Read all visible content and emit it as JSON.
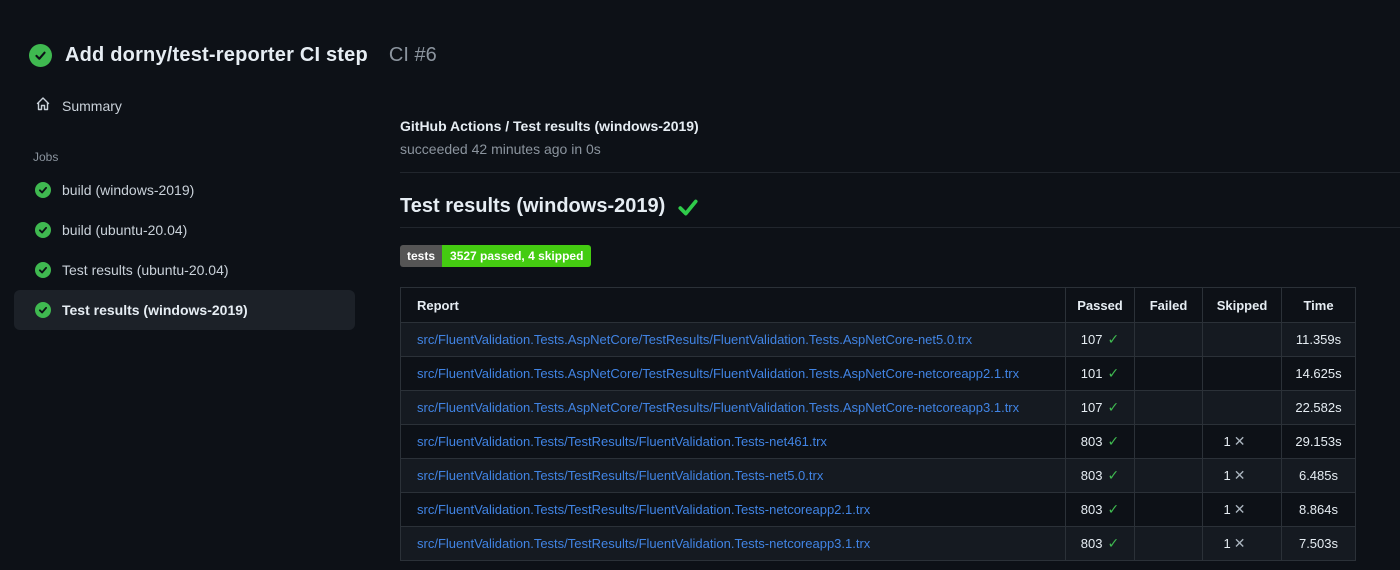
{
  "header": {
    "title": "Add dorny/test-reporter CI step",
    "run_number": "CI #6"
  },
  "sidebar": {
    "summary_label": "Summary",
    "jobs_label": "Jobs",
    "jobs": [
      {
        "label": "build (windows-2019)",
        "status": "success",
        "selected": false
      },
      {
        "label": "build (ubuntu-20.04)",
        "status": "success",
        "selected": false
      },
      {
        "label": "Test results (ubuntu-20.04)",
        "status": "success",
        "selected": false
      },
      {
        "label": "Test results (windows-2019)",
        "status": "success",
        "selected": true
      }
    ]
  },
  "main": {
    "check_run_title": "GitHub Actions / Test results (windows-2019)",
    "check_run_status": "succeeded 42 minutes ago in 0s",
    "section_title": "Test results (windows-2019)",
    "badge": {
      "label": "tests",
      "value": "3527 passed, 4 skipped",
      "label_bg": "#555555",
      "value_bg": "#44cc11"
    },
    "table": {
      "columns": [
        "Report",
        "Passed",
        "Failed",
        "Skipped",
        "Time"
      ],
      "rows": [
        {
          "report": "src/FluentValidation.Tests.AspNetCore/TestResults/FluentValidation.Tests.AspNetCore-net5.0.trx",
          "passed": "107",
          "failed": "",
          "skipped": "",
          "time": "11.359s"
        },
        {
          "report": "src/FluentValidation.Tests.AspNetCore/TestResults/FluentValidation.Tests.AspNetCore-netcoreapp2.1.trx",
          "passed": "101",
          "failed": "",
          "skipped": "",
          "time": "14.625s"
        },
        {
          "report": "src/FluentValidation.Tests.AspNetCore/TestResults/FluentValidation.Tests.AspNetCore-netcoreapp3.1.trx",
          "passed": "107",
          "failed": "",
          "skipped": "",
          "time": "22.582s"
        },
        {
          "report": "src/FluentValidation.Tests/TestResults/FluentValidation.Tests-net461.trx",
          "passed": "803",
          "failed": "",
          "skipped": "1",
          "time": "29.153s"
        },
        {
          "report": "src/FluentValidation.Tests/TestResults/FluentValidation.Tests-net5.0.trx",
          "passed": "803",
          "failed": "",
          "skipped": "1",
          "time": "6.485s"
        },
        {
          "report": "src/FluentValidation.Tests/TestResults/FluentValidation.Tests-netcoreapp2.1.trx",
          "passed": "803",
          "failed": "",
          "skipped": "1",
          "time": "8.864s"
        },
        {
          "report": "src/FluentValidation.Tests/TestResults/FluentValidation.Tests-netcoreapp3.1.trx",
          "passed": "803",
          "failed": "",
          "skipped": "1",
          "time": "7.503s"
        }
      ]
    }
  },
  "icons": {
    "check": "✓",
    "cross": "✕"
  },
  "colors": {
    "background": "#0d1117",
    "accent_green": "#3fb950",
    "badge_green": "#44cc11",
    "badge_gray": "#555555",
    "link_blue": "#4184e4",
    "row_alt": "#151a21",
    "selected_item_bg": "#1c2128",
    "muted_text": "#8b949e",
    "border": "#2b3138"
  }
}
